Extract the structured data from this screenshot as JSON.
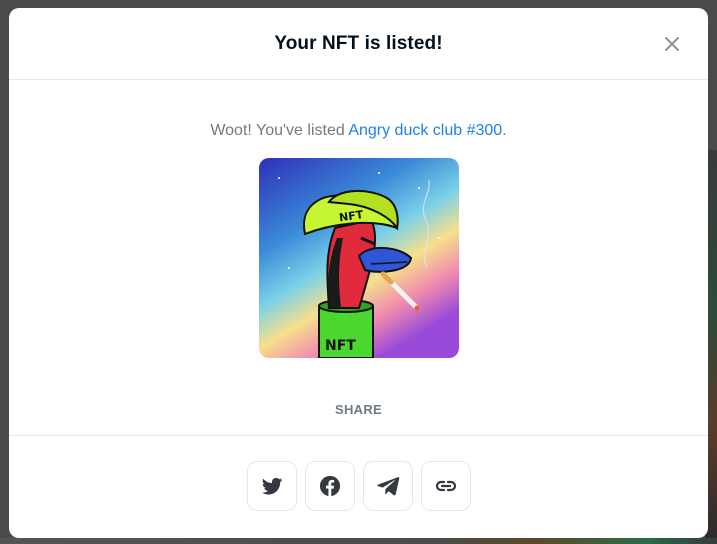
{
  "modal": {
    "title": "Your NFT is listed!",
    "message_prefix": "Woot! You've listed ",
    "nft_name": "Angry duck club #300",
    "message_suffix": ".",
    "share_label": "SHARE",
    "share_buttons": [
      {
        "icon": "twitter-icon"
      },
      {
        "icon": "facebook-icon"
      },
      {
        "icon": "telegram-icon"
      },
      {
        "icon": "link-icon"
      }
    ]
  },
  "colors": {
    "title": "#04111d",
    "muted": "#707a83",
    "link": "#2081e2",
    "icon": "#353840",
    "border": "#e5e8eb"
  }
}
